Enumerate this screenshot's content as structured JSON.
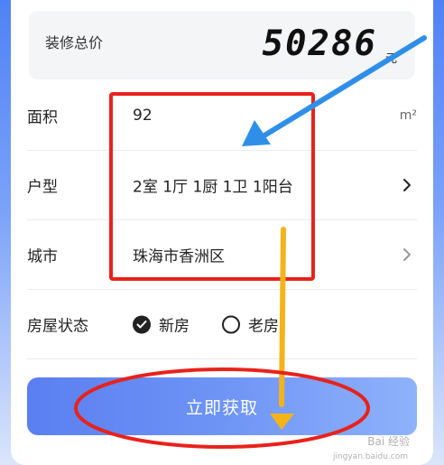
{
  "total": {
    "label": "装修总价",
    "value": "50286",
    "unit": "元"
  },
  "fields": {
    "area": {
      "label": "面积",
      "value": "92",
      "unit": "m²"
    },
    "layout": {
      "label": "户型",
      "value": "2室 1厅 1厨 1卫 1阳台"
    },
    "city": {
      "label": "城市",
      "value": "珠海市香洲区"
    },
    "house_status": {
      "label": "房屋状态",
      "options": [
        {
          "label": "新房",
          "selected": true
        },
        {
          "label": "老房",
          "selected": false
        }
      ]
    }
  },
  "actions": {
    "submit_label": "立即获取"
  },
  "watermark": {
    "brand": "Bai 经验",
    "url": "jingyan.baidu.com"
  },
  "colors": {
    "primary_blue": "#5a7ff1",
    "annotation_red": "#e8221b",
    "annotation_blue": "#2f8fe8",
    "annotation_yellow": "#f5b31a"
  }
}
